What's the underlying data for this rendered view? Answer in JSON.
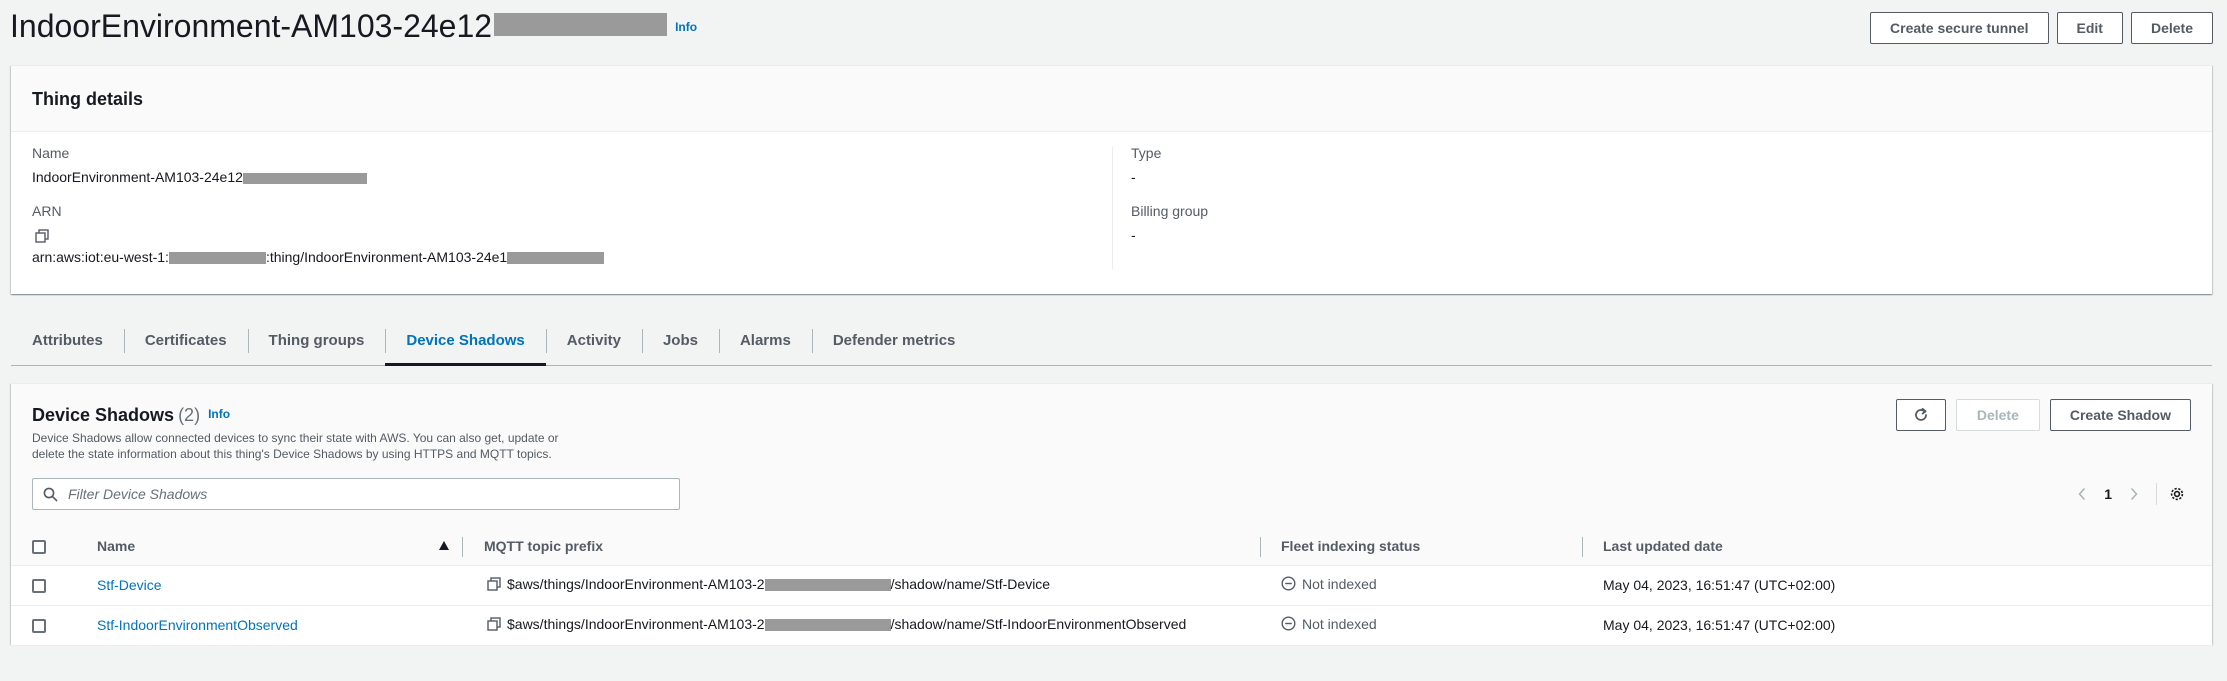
{
  "header": {
    "title": "IndoorEnvironment-AM103-24e12",
    "info": "Info",
    "buttons": {
      "tunnel": "Create secure tunnel",
      "edit": "Edit",
      "delete": "Delete"
    }
  },
  "details": {
    "title": "Thing details",
    "name_label": "Name",
    "name_value": "IndoorEnvironment-AM103-24e12",
    "arn_label": "ARN",
    "arn_prefix": "arn:aws:iot:eu-west-1:",
    "arn_mid": ":thing/IndoorEnvironment-AM103-24e1",
    "type_label": "Type",
    "type_value": "-",
    "billing_label": "Billing group",
    "billing_value": "-"
  },
  "tabs": [
    {
      "label": "Attributes"
    },
    {
      "label": "Certificates"
    },
    {
      "label": "Thing groups"
    },
    {
      "label": "Device Shadows"
    },
    {
      "label": "Activity"
    },
    {
      "label": "Jobs"
    },
    {
      "label": "Alarms"
    },
    {
      "label": "Defender metrics"
    }
  ],
  "active_tab": "Device Shadows",
  "shadows": {
    "title": "Device Shadows",
    "count": "(2)",
    "info": "Info",
    "description": "Device Shadows allow connected devices to sync their state with AWS. You can also get, update or delete the state information about this thing's Device Shadows by using HTTPS and MQTT topics.",
    "buttons": {
      "delete": "Delete",
      "create": "Create Shadow"
    },
    "search_placeholder": "Filter Device Shadows",
    "page": "1",
    "columns": {
      "name": "Name",
      "mqtt": "MQTT topic prefix",
      "fleet": "Fleet indexing status",
      "updated": "Last updated date"
    },
    "rows": [
      {
        "name": "Stf-Device",
        "mqtt_prefix": "$aws/things/IndoorEnvironment-AM103-2",
        "mqtt_suffix": "/shadow/name/Stf-Device",
        "fleet": "Not indexed",
        "updated": "May 04, 2023, 16:51:47 (UTC+02:00)"
      },
      {
        "name": "Stf-IndoorEnvironmentObserved",
        "mqtt_prefix": "$aws/things/IndoorEnvironment-AM103-2",
        "mqtt_suffix": "/shadow/name/Stf-IndoorEnvironmentObserved",
        "fleet": "Not indexed",
        "updated": "May 04, 2023, 16:51:47 (UTC+02:00)"
      }
    ]
  },
  "colors": {
    "link": "#0073bb",
    "text": "#16191f",
    "muted": "#545b64",
    "background": "#f2f3f3",
    "redaction": "#9a9a9a"
  }
}
